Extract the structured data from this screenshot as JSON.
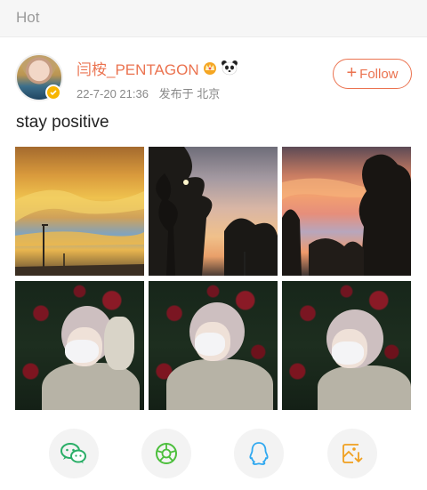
{
  "section": {
    "title": "Hot"
  },
  "post": {
    "username": "闫桉_PENTAGON",
    "date": "22-7-20 21:36",
    "location": "发布于 北京",
    "follow_label": "Follow",
    "follow_plus": "+",
    "text": "stay positive",
    "photos": [
      "sunset-sky-streetlamp",
      "sunset-tree-silhouette",
      "sunset-trees-pink-sky",
      "portrait-roses-1",
      "portrait-roses-2",
      "portrait-roses-3"
    ]
  },
  "share": {
    "buttons": [
      "wechat-icon",
      "moments-icon",
      "qq-icon",
      "save-image-icon"
    ]
  },
  "colors": {
    "accent": "#eb7350",
    "header_text": "#9a9a9a",
    "meta_text": "#888888",
    "wechat": "#2aae67",
    "moments": "#4cbf3c",
    "qq": "#2fa8f0",
    "save": "#f0a020"
  }
}
